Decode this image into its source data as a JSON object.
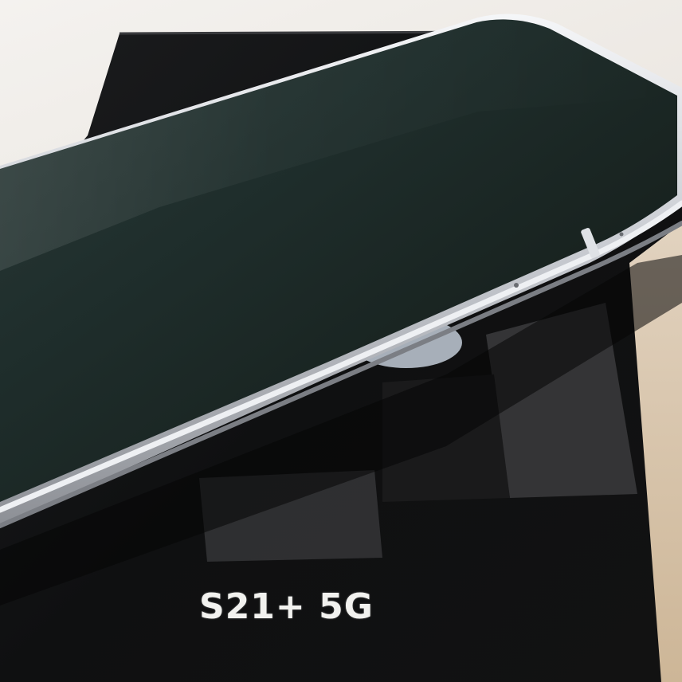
{
  "photo": {
    "box_label": "S21+ 5G",
    "subjects": [
      "smartphone",
      "product-box"
    ],
    "colors": {
      "box": "#111213",
      "phone_glass": "#1f2c2a",
      "phone_frame": "#c9ccd2",
      "background": "#efece8",
      "table": "#d9c6ad"
    }
  }
}
